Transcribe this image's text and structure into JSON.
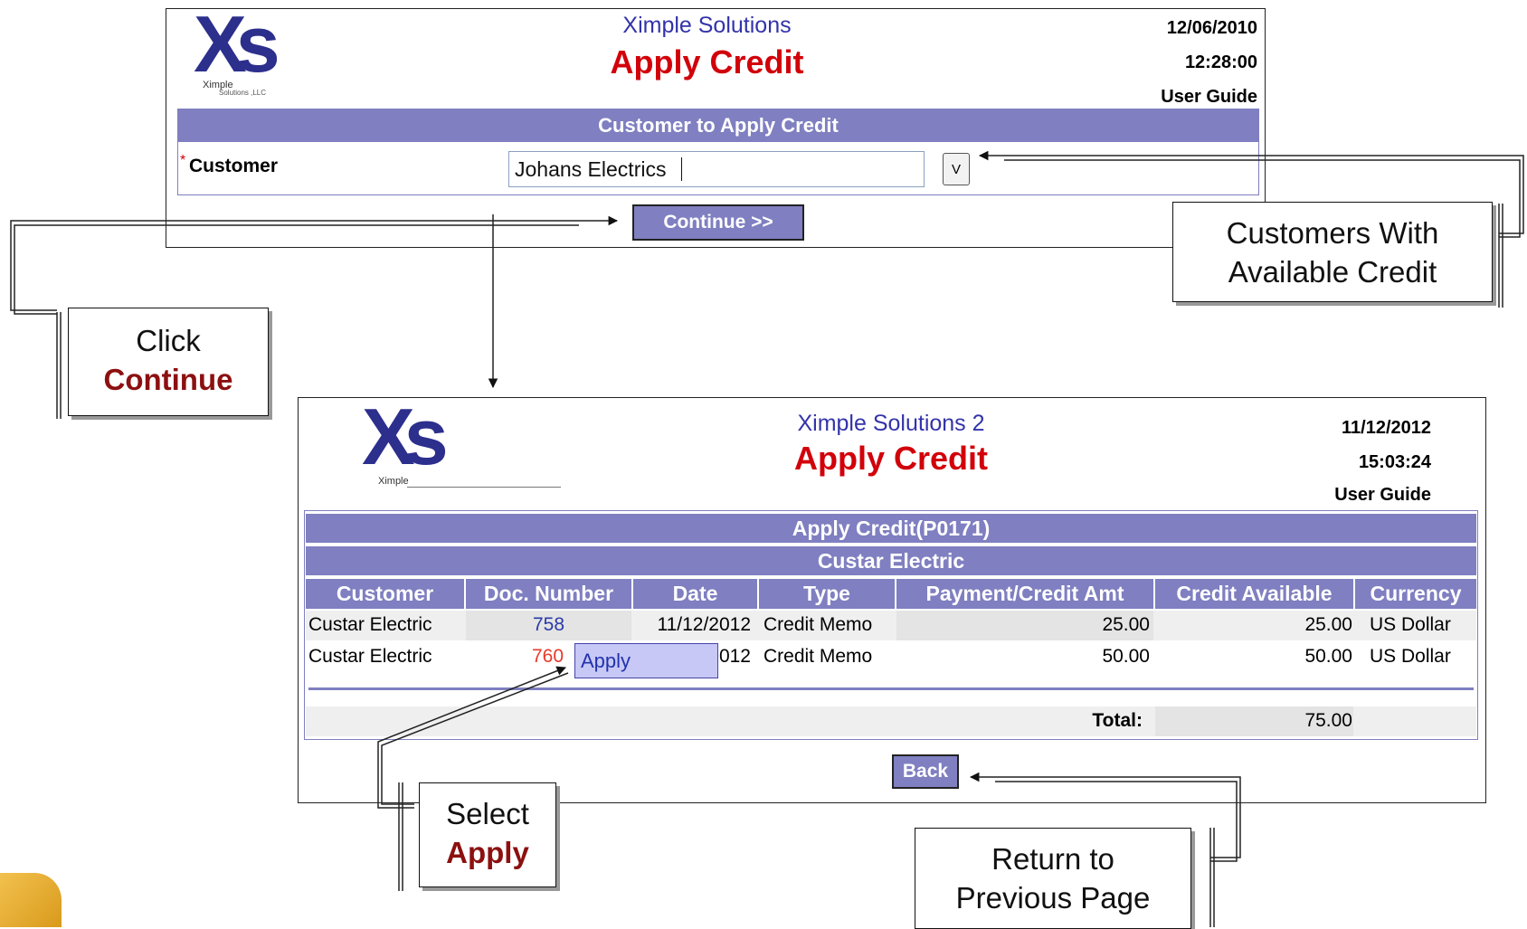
{
  "screen1": {
    "company": "Ximple Solutions",
    "title": "Apply Credit",
    "date": "12/06/2010",
    "time": "12:28:00",
    "guide": "User Guide",
    "logo_text": "Xs",
    "logo_sub": "Ximple",
    "logo_sub2": "Solutions ,LLC",
    "section_header": "Customer to Apply Credit",
    "required_mark": "*",
    "customer_label": "Customer",
    "customer_value": "Johans Electrics",
    "dropdown_label": "V",
    "continue_label": "Continue >>"
  },
  "screen2": {
    "company": "Ximple Solutions 2",
    "title": "Apply Credit",
    "date": "11/12/2012",
    "time": "15:03:24",
    "guide": "User Guide",
    "logo_text": "Xs",
    "logo_sub": "Ximple",
    "header1": "Apply Credit(P0171)",
    "header2": "Custar Electric",
    "columns": [
      "Customer",
      "Doc. Number",
      "Date",
      "Type",
      "Payment/Credit Amt",
      "Credit Available",
      "Currency"
    ],
    "rows": [
      {
        "customer": "Custar Electric",
        "doc": "758",
        "date": "11/12/2012",
        "type": "Credit Memo",
        "amount": "25.00",
        "available": "25.00",
        "currency": "US Dollar"
      },
      {
        "customer": "Custar Electric",
        "doc": "760",
        "date": "012",
        "type": "Credit Memo",
        "amount": "50.00",
        "available": "50.00",
        "currency": "US Dollar"
      }
    ],
    "popup_label": "Apply",
    "total_label": "Total:",
    "total_value": "75.00",
    "back_label": "Back"
  },
  "callouts": {
    "customers_line1": "Customers With",
    "customers_line2": "Available Credit",
    "click_line1": "Click",
    "click_line2": "Continue",
    "select_line1": "Select",
    "select_line2": "Apply",
    "return_line1": "Return to",
    "return_line2": "Previous Page"
  },
  "colors": {
    "header_bar": "#7f7fc1",
    "title_red": "#d1000a",
    "company_blue": "#3333aa",
    "link_blue": "#2a3aa8",
    "link_red": "#e8392a",
    "callout_emphasis": "#8c1010"
  }
}
